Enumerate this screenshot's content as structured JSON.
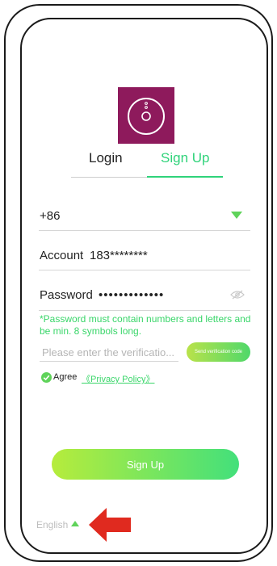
{
  "colors": {
    "accent": "#2fd37a",
    "logo_bg": "#8e1a5c",
    "annotation_arrow": "#e02a1f"
  },
  "tabs": {
    "login": "Login",
    "signup": "Sign Up",
    "active": "signup"
  },
  "country_code": "+86",
  "account": {
    "label": "Account",
    "value": "183********"
  },
  "password": {
    "label": "Password",
    "value": "•••••••••••••"
  },
  "password_hint": "*Password must contain numbers and letters and be min. 8 symbols long.",
  "verification": {
    "placeholder": "Please enter the verificatio...",
    "send_label": "Send verification code"
  },
  "agree": {
    "label": "Agree",
    "link": "《Privacy Policy》"
  },
  "submit_label": "Sign Up",
  "language": "English",
  "icons": [
    "robot-vacuum-logo-icon",
    "dropdown-arrow-icon",
    "eye-hidden-icon",
    "check-icon",
    "language-arrow-icon",
    "red-annotation-arrow-icon"
  ]
}
